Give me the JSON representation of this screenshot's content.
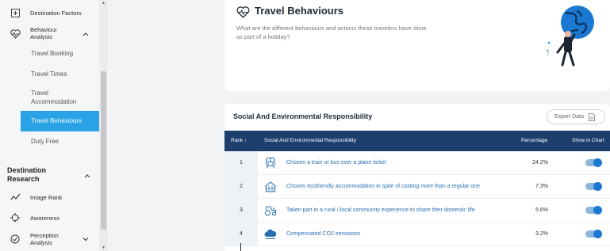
{
  "sidebar": {
    "items": [
      {
        "label": "Destination Factors",
        "icon": "factors-icon"
      },
      {
        "label": "Behaviour\nAnalysis",
        "icon": "heart-pulse-icon",
        "expanded": true
      }
    ],
    "sub_items": [
      {
        "label": "Travel Booking",
        "active": false
      },
      {
        "label": "Travel Times",
        "active": false
      },
      {
        "label": "Travel\nAccommodation",
        "active": false
      },
      {
        "label": "Travel Behaviours",
        "active": true
      },
      {
        "label": "Duty Free",
        "active": false
      }
    ],
    "section": {
      "title": "Destination\nResearch",
      "expanded": true
    },
    "section_items": [
      {
        "label": "Image Rank",
        "icon": "trend-line-icon"
      },
      {
        "label": "Awareness",
        "icon": "crosshair-icon"
      },
      {
        "label": "Perception\nAnalysis",
        "icon": "check-circle-icon"
      }
    ]
  },
  "header": {
    "title": "Travel Behaviours",
    "icon": "heart-pulse-icon",
    "description": "What are the different behaviours and actions these travelers have done as part of a holiday?"
  },
  "table": {
    "title": "Social And Environmental Responsibility",
    "export_label": "Export Data",
    "columns": {
      "rank": "Rank",
      "name": "Social And Environmental Responsibility",
      "percentage": "Percentage",
      "show": "Show in Chart"
    },
    "rows": [
      {
        "rank": "1",
        "label": "Chosen a train or bus over a plane ticket",
        "percentage": "24.2%",
        "icon": "train-icon",
        "shown": true
      },
      {
        "rank": "2",
        "label": "Chosen ecofriendly accommodation in spite of costing more than a regular one",
        "percentage": "7.3%",
        "icon": "eco-house-icon",
        "shown": true
      },
      {
        "rank": "3",
        "label": "Taken part in a rural / local community experience to share their domestic life",
        "percentage": "5.6%",
        "icon": "tractor-icon",
        "shown": true
      },
      {
        "rank": "4",
        "label": "Compensated CO2 emissions",
        "percentage": "3.2%",
        "icon": "co2-cloud-icon",
        "shown": true
      }
    ]
  },
  "colors": {
    "accent": "#29a3e6",
    "table_header": "#1d3f6e",
    "link": "#2a6fb2",
    "toggle": "#1b78d0"
  }
}
